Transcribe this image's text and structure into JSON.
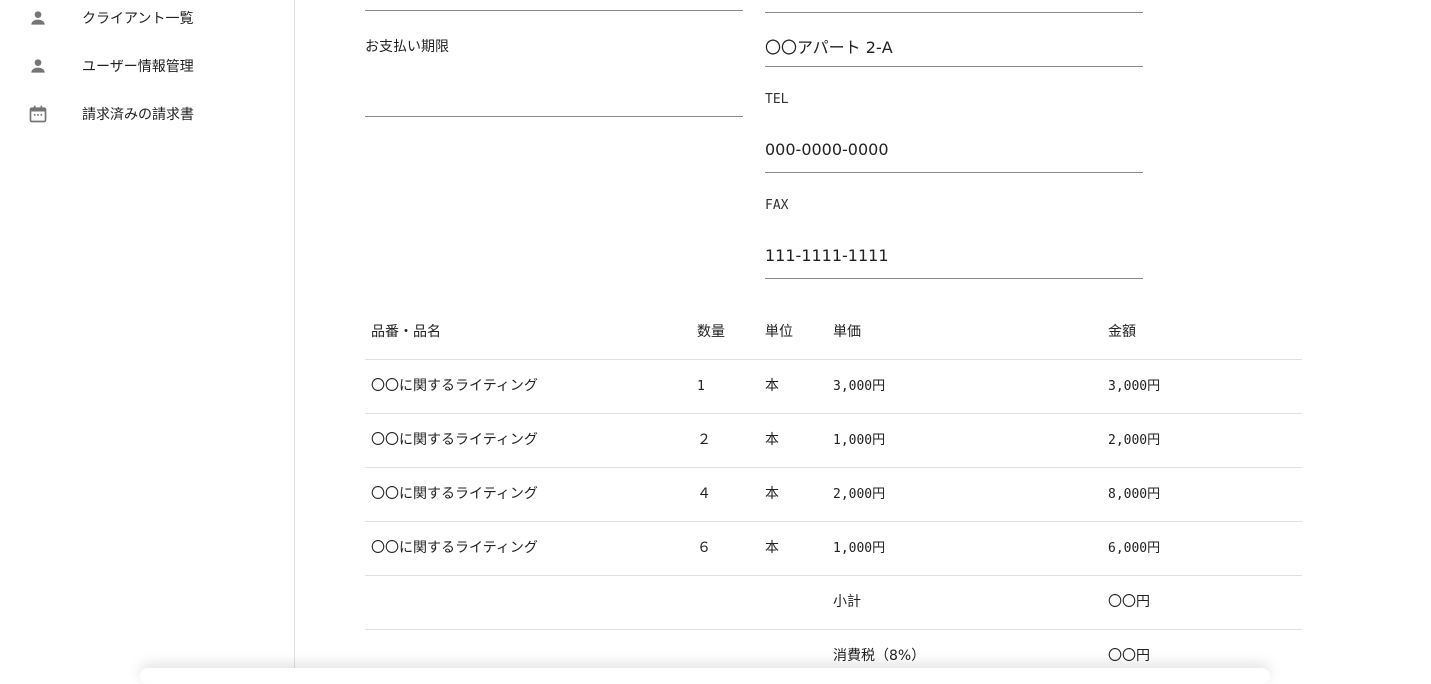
{
  "sidebar": {
    "items": [
      {
        "label": "クライアント一覧",
        "icon": "person-icon"
      },
      {
        "label": "ユーザー情報管理",
        "icon": "person-icon"
      },
      {
        "label": "請求済みの請求書",
        "icon": "calendar-icon"
      }
    ]
  },
  "form": {
    "due_label": "お支払い期限",
    "due_value": "",
    "address_value": "〇〇アパート 2-A",
    "tel_label": "TEL",
    "tel_value": "000-0000-0000",
    "fax_label": "FAX",
    "fax_value": "111-1111-1111"
  },
  "table": {
    "headers": {
      "name": "品番・品名",
      "qty": "数量",
      "unit": "単位",
      "price": "単価",
      "amount": "金額"
    },
    "rows": [
      {
        "name": "〇〇に関するライティング",
        "qty": "1",
        "unit": "本",
        "price": "3,000円",
        "amount": "3,000円"
      },
      {
        "name": "〇〇に関するライティング",
        "qty": "２",
        "unit": "本",
        "price": "1,000円",
        "amount": "2,000円"
      },
      {
        "name": "〇〇に関するライティング",
        "qty": "４",
        "unit": "本",
        "price": "2,000円",
        "amount": "8,000円"
      },
      {
        "name": "〇〇に関するライティング",
        "qty": "６",
        "unit": "本",
        "price": "1,000円",
        "amount": "6,000円"
      }
    ],
    "subtotal": {
      "label": "小計",
      "value": "〇〇円"
    },
    "tax": {
      "label": "消費税（8%）",
      "value": "〇〇円"
    }
  }
}
